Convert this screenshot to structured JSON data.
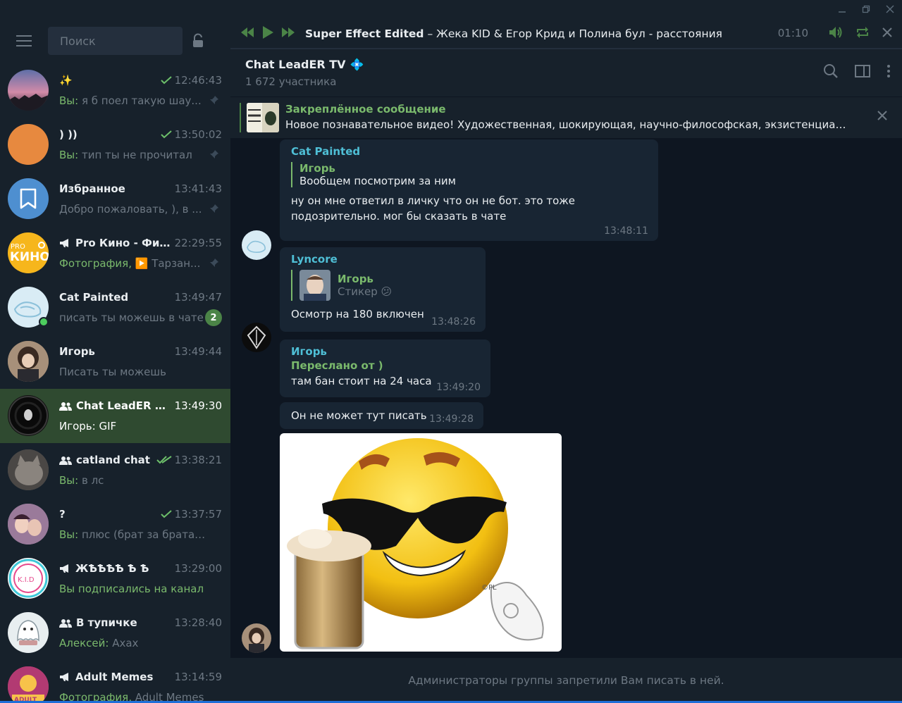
{
  "colors": {
    "accent_green": "#7ab96c",
    "active_row": "#2b5278",
    "bg_dark": "#0e1621",
    "panel": "#17212b",
    "bubble": "#182533",
    "muted": "#6d7883",
    "link_blue": "#4c9ce2"
  },
  "sidebar": {
    "search_placeholder": "Поиск",
    "dialogs": [
      {
        "title": "✨",
        "time": "12:46:43",
        "check": "single",
        "sender": "Вы:",
        "text": "я б поел такую шау...",
        "pinned": true,
        "icon": ""
      },
      {
        "title": ") ))",
        "time": "13:50:02",
        "check": "single",
        "sender": "Вы:",
        "text": "тип ты не прочитал",
        "pinned": true,
        "icon": ""
      },
      {
        "title": "Избранное",
        "time": "13:41:43",
        "check": "",
        "sender": "",
        "text": "Добро пожаловать, ), в ...",
        "pinned": true,
        "icon": ""
      },
      {
        "title": "Pro Кино - Фил...",
        "time": "22:29:55",
        "check": "",
        "sender": "Фотография,",
        "text": "▶️ Тарзан...",
        "pinned": true,
        "icon": "megaphone-icon"
      },
      {
        "title": "Cat Painted",
        "time": "13:49:47",
        "check": "",
        "sender": "",
        "text": "писать ты можешь в чате",
        "badge": "2",
        "icon": ""
      },
      {
        "title": "Игорь",
        "time": "13:49:44",
        "check": "",
        "sender": "",
        "text": "Писать ты можешь",
        "icon": ""
      },
      {
        "title": "Chat LeadER TV ...",
        "time": "13:49:30",
        "check": "",
        "sender": "Игорь:",
        "text": "GIF",
        "icon": "group-icon",
        "active": true
      },
      {
        "title": "catland chat",
        "time": "13:38:21",
        "check": "double",
        "sender": "Вы:",
        "text": "в лс",
        "icon": "group-icon"
      },
      {
        "title": "?",
        "time": "13:37:57",
        "check": "single",
        "sender": "Вы:",
        "text": "плюс (брат за брата) эта...",
        "icon": ""
      },
      {
        "title": "ЖѢѢѢѢ Ѣ Ѣ",
        "time": "13:29:00",
        "check": "",
        "sender": "",
        "text": "Вы подписались на канал",
        "icon": "megaphone-icon",
        "green": true
      },
      {
        "title": "В тупичке",
        "time": "13:28:40",
        "check": "",
        "sender": "Алексей:",
        "text": "Ахах",
        "icon": "group-icon"
      },
      {
        "title": "Adult Memes",
        "time": "13:14:59",
        "check": "",
        "sender": "Фотография,",
        "text": "Adult Memes",
        "icon": "megaphone-icon"
      }
    ]
  },
  "player": {
    "track_bold": "Super Effect Edited",
    "track_rest": " – Жека KID & Егор Крид и Полина бул - расстояния",
    "time": "01:10",
    "progress": 0.0
  },
  "chat": {
    "name": "Chat LeadER TV",
    "name_emoji": "💠",
    "members": "1 672 участника"
  },
  "pinned": {
    "title": "Закреплённое сообщение",
    "text": "Новое познавательное видео!  Художественная, шокирующая, научно-философская, экзистенциальная, документальная, иллюстрированная и очень познавательная история..."
  },
  "messages": [
    {
      "from": "Cat Painted",
      "reply_name": "Игорь",
      "reply_text": "Вообщем посмотрим за ним",
      "text1": "ну он мне ответил в личку что он не бот. это тоже",
      "text2": "подозрительно. мог бы сказать в чате",
      "time": "13:48:11"
    },
    {
      "from": "Lyncore",
      "reply_name": "Игорь",
      "reply_text": "Стикер 😕",
      "text1": "Осмотр на 180 включен",
      "time": "13:48:26"
    },
    {
      "from": "Игорь",
      "forward": "Переслано от )",
      "text1": "там бан стоит на 24 часа",
      "time": "13:49:20"
    },
    {
      "text1": "Он не может тут писать",
      "time": "13:49:28"
    }
  ],
  "composer": {
    "notice": "Администраторы группы запретили Вам писать в ней."
  }
}
